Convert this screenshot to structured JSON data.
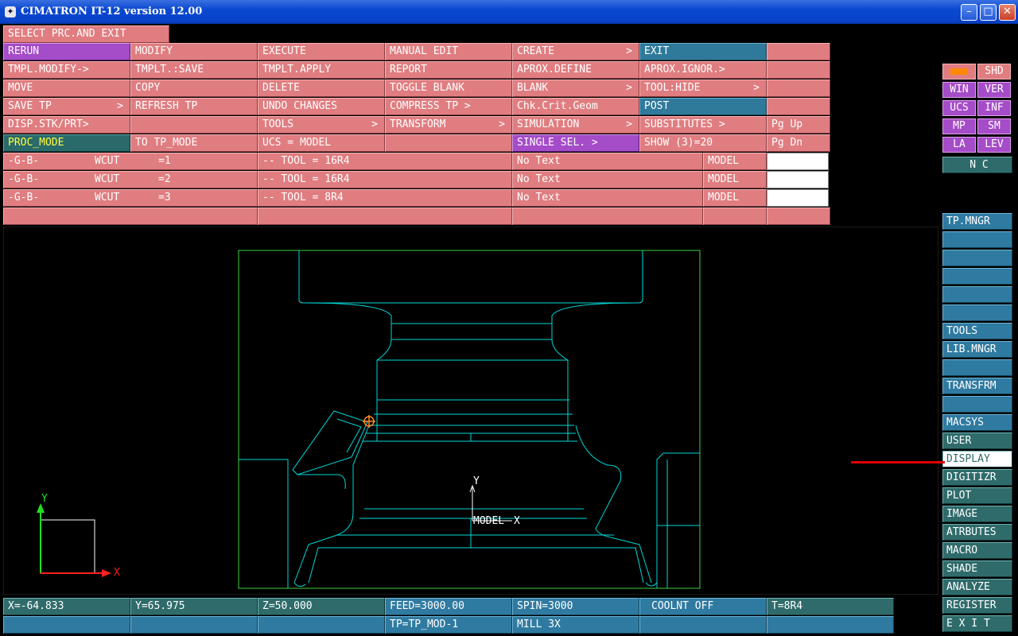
{
  "window": {
    "title": "CIMATRON IT-12 version 12.00",
    "icon": "cimatron-app-icon"
  },
  "prompt": "SELECT PRC.AND EXIT",
  "menu_rows": [
    [
      "RERUN",
      "MODIFY",
      "EXECUTE",
      "MANUAL EDIT",
      "CREATE",
      "EXIT",
      ""
    ],
    [
      "TMPL.MODIFY->",
      "TMPLT.:SAVE",
      "TMPLT.APPLY",
      "REPORT",
      "APROX.DEFINE",
      "APROX.IGNOR.>",
      ""
    ],
    [
      "MOVE",
      "COPY",
      "DELETE",
      "TOGGLE BLANK",
      "BLANK",
      "TOOL:HIDE",
      ""
    ],
    [
      "SAVE TP",
      "REFRESH TP",
      "UNDO CHANGES",
      "COMPRESS TP >",
      "Chk.Crit.Geom",
      "POST",
      ""
    ],
    [
      "DISP.STK/PRT>",
      "",
      "TOOLS",
      "TRANSFORM",
      "SIMULATION",
      "SUBSTITUTES >",
      "Pg Up"
    ],
    [
      "PROC_MODE",
      "TO TP_MODE",
      "UCS = MODEL",
      "",
      "SINGLE SEL. >",
      "SHOW (3)=20",
      "Pg Dn"
    ]
  ],
  "menu_arrow": ">",
  "procedures": [
    {
      "group": "-G-B-",
      "name": "WCUT",
      "value": "=1",
      "tool": "-- TOOL = 16R4",
      "text": "No Text",
      "space": "MODEL"
    },
    {
      "group": "-G-B-",
      "name": "WCUT",
      "value": "=2",
      "tool": "-- TOOL = 16R4",
      "text": "No Text",
      "space": "MODEL"
    },
    {
      "group": "-G-B-",
      "name": "WCUT",
      "value": "=3",
      "tool": "-- TOOL = 8R4",
      "text": "No Text",
      "space": "MODEL"
    }
  ],
  "small_buttons": [
    {
      "label": "",
      "style": "pink"
    },
    {
      "label": "SHD",
      "style": "pink"
    },
    {
      "label": "WIN",
      "style": "purple"
    },
    {
      "label": "VER",
      "style": "purple"
    },
    {
      "label": "UCS",
      "style": "purple"
    },
    {
      "label": "INF",
      "style": "purple"
    },
    {
      "label": "MP",
      "style": "purple"
    },
    {
      "label": "SM",
      "style": "purple"
    },
    {
      "label": "LA",
      "style": "purple"
    },
    {
      "label": "LEV",
      "style": "purple"
    }
  ],
  "nc_label": "N C",
  "right_menu": [
    "TP.MNGR",
    "",
    "",
    "",
    "",
    "",
    "TOOLS",
    "LIB.MNGR",
    "",
    "TRANSFRM",
    "",
    "MACSYS",
    "USER",
    "DISPLAY",
    "DIGITIZR",
    "PLOT",
    "IMAGE",
    "ATRBUTES",
    "MACRO",
    "SHADE",
    "ANALYZE",
    "REGISTER",
    "E X I T"
  ],
  "viewport": {
    "axis_x": "X",
    "axis_y": "Y",
    "model_label": "MODEL",
    "model_x": "X",
    "model_y": "Y",
    "colors": {
      "model": "#00e0e0",
      "frame": "#40d040",
      "axis_x": "#ff2020",
      "axis_y": "#20e020",
      "cursor": "#ff8a20"
    }
  },
  "status_bar": {
    "x": "X=-64.833",
    "y": "Y=65.975",
    "z": "Z=50.000",
    "feed": "FEED=3000.00",
    "spin": "SPIN=3000",
    "coolant": "COOLNT OFF",
    "tool": "T=8R4",
    "tp": "TP=TP_MOD-1",
    "mill": "MILL 3X"
  },
  "colors": {
    "menu": "#e07d80",
    "selected": "#a54cc8",
    "active_blue": "#2f7a9a",
    "side": "#2f6b6b"
  }
}
